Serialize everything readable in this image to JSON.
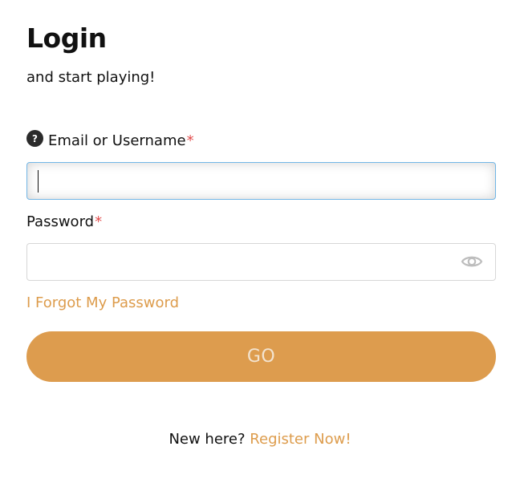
{
  "header": {
    "title": "Login",
    "subtitle": "and start playing!"
  },
  "form": {
    "email": {
      "label": "Email or Username",
      "required_mark": "*",
      "value": "",
      "help_icon": "question-mark-icon",
      "help_glyph": "?"
    },
    "password": {
      "label": "Password",
      "required_mark": "*",
      "value": "",
      "toggle_icon": "eye-icon"
    },
    "forgot_link": "I Forgot My Password",
    "submit_label": "GO"
  },
  "footer": {
    "prompt": "New here?",
    "register_link": "Register Now!"
  },
  "colors": {
    "accent": "#dd9c4e",
    "required": "#e24b4b",
    "focus_border": "#72b6e6"
  }
}
